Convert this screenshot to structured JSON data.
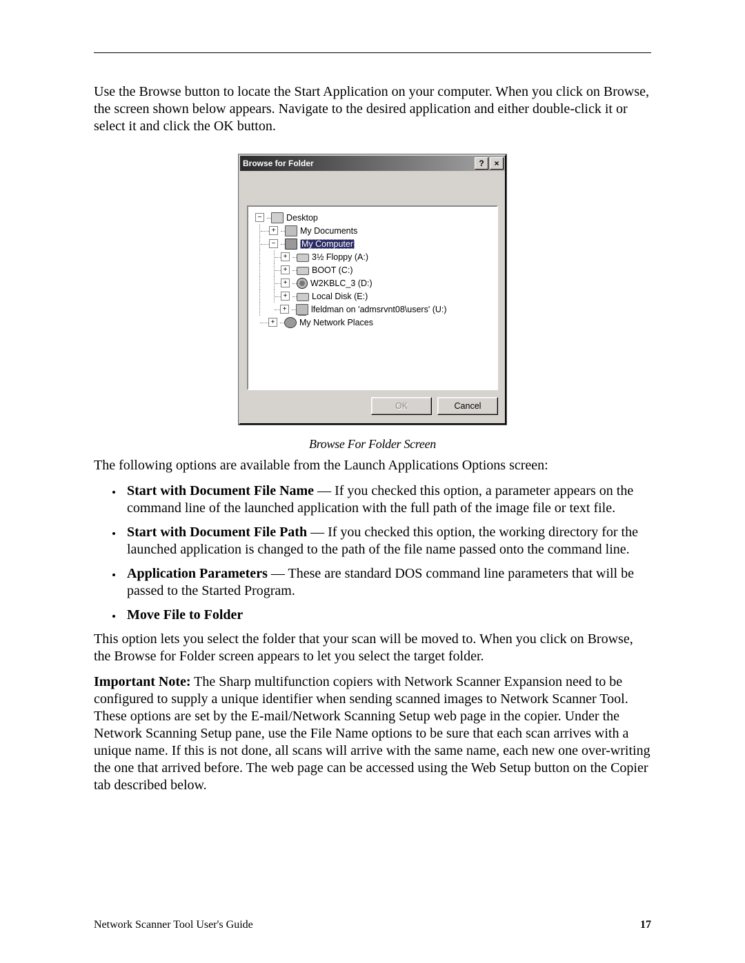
{
  "intro": "Use the Browse button to locate the Start Application on your computer. When you click on Browse, the screen shown below appears. Navigate to the desired application and either double-click it or select it and click the OK button.",
  "dialog": {
    "title": "Browse for Folder",
    "help_glyph": "?",
    "close_glyph": "×",
    "tree": {
      "root": "Desktop",
      "my_documents": "My Documents",
      "my_computer": "My Computer",
      "floppy": "3½ Floppy (A:)",
      "boot": "BOOT (C:)",
      "w2k": "W2KBLC_3 (D:)",
      "local": "Local Disk (E:)",
      "netdrv": "lfeldman on 'admsrvnt08\\users' (U:)",
      "places": "My Network Places"
    },
    "ok_label": "OK",
    "cancel_label": "Cancel"
  },
  "caption": "Browse For Folder Screen",
  "options_intro": "The following options are available from the Launch Applications Options screen:",
  "options": {
    "o1_bold": "Start with Document File Name",
    "o1_rest": " — If you checked this option, a parameter appears on the command line of the launched application with the full path of the image file or text file.",
    "o2_bold": "Start with Document File Path",
    "o2_rest": " — If you checked this option, the working directory for the launched application is changed to the path of the file name passed onto the command line.",
    "o3_bold": "Application Parameters",
    "o3_rest": " — These are standard DOS command line parameters that will be passed to the Started Program.",
    "o4_bold": "Move File to Folder"
  },
  "move_para": "This option lets you select the folder that your scan will be moved to. When you click on Browse, the Browse for Folder screen appears to let you select the target folder.",
  "note_bold": "Important Note:",
  "note_rest": " The Sharp multifunction copiers with Network Scanner Expansion need to be configured to supply a unique identifier when sending scanned images to Network Scanner Tool.  These options are set by the E-mail/Network Scanning Setup web page in the copier.  Under the Network Scanning Setup pane, use the File Name options to be sure that each scan arrives with a unique name.  If this is not done, all scans will arrive with the same name, each new one over-writing the one that arrived before.  The web page can be accessed using the Web Setup button on the Copier tab described below.",
  "footer": {
    "left": "Network Scanner Tool User's Guide",
    "page": "17"
  }
}
